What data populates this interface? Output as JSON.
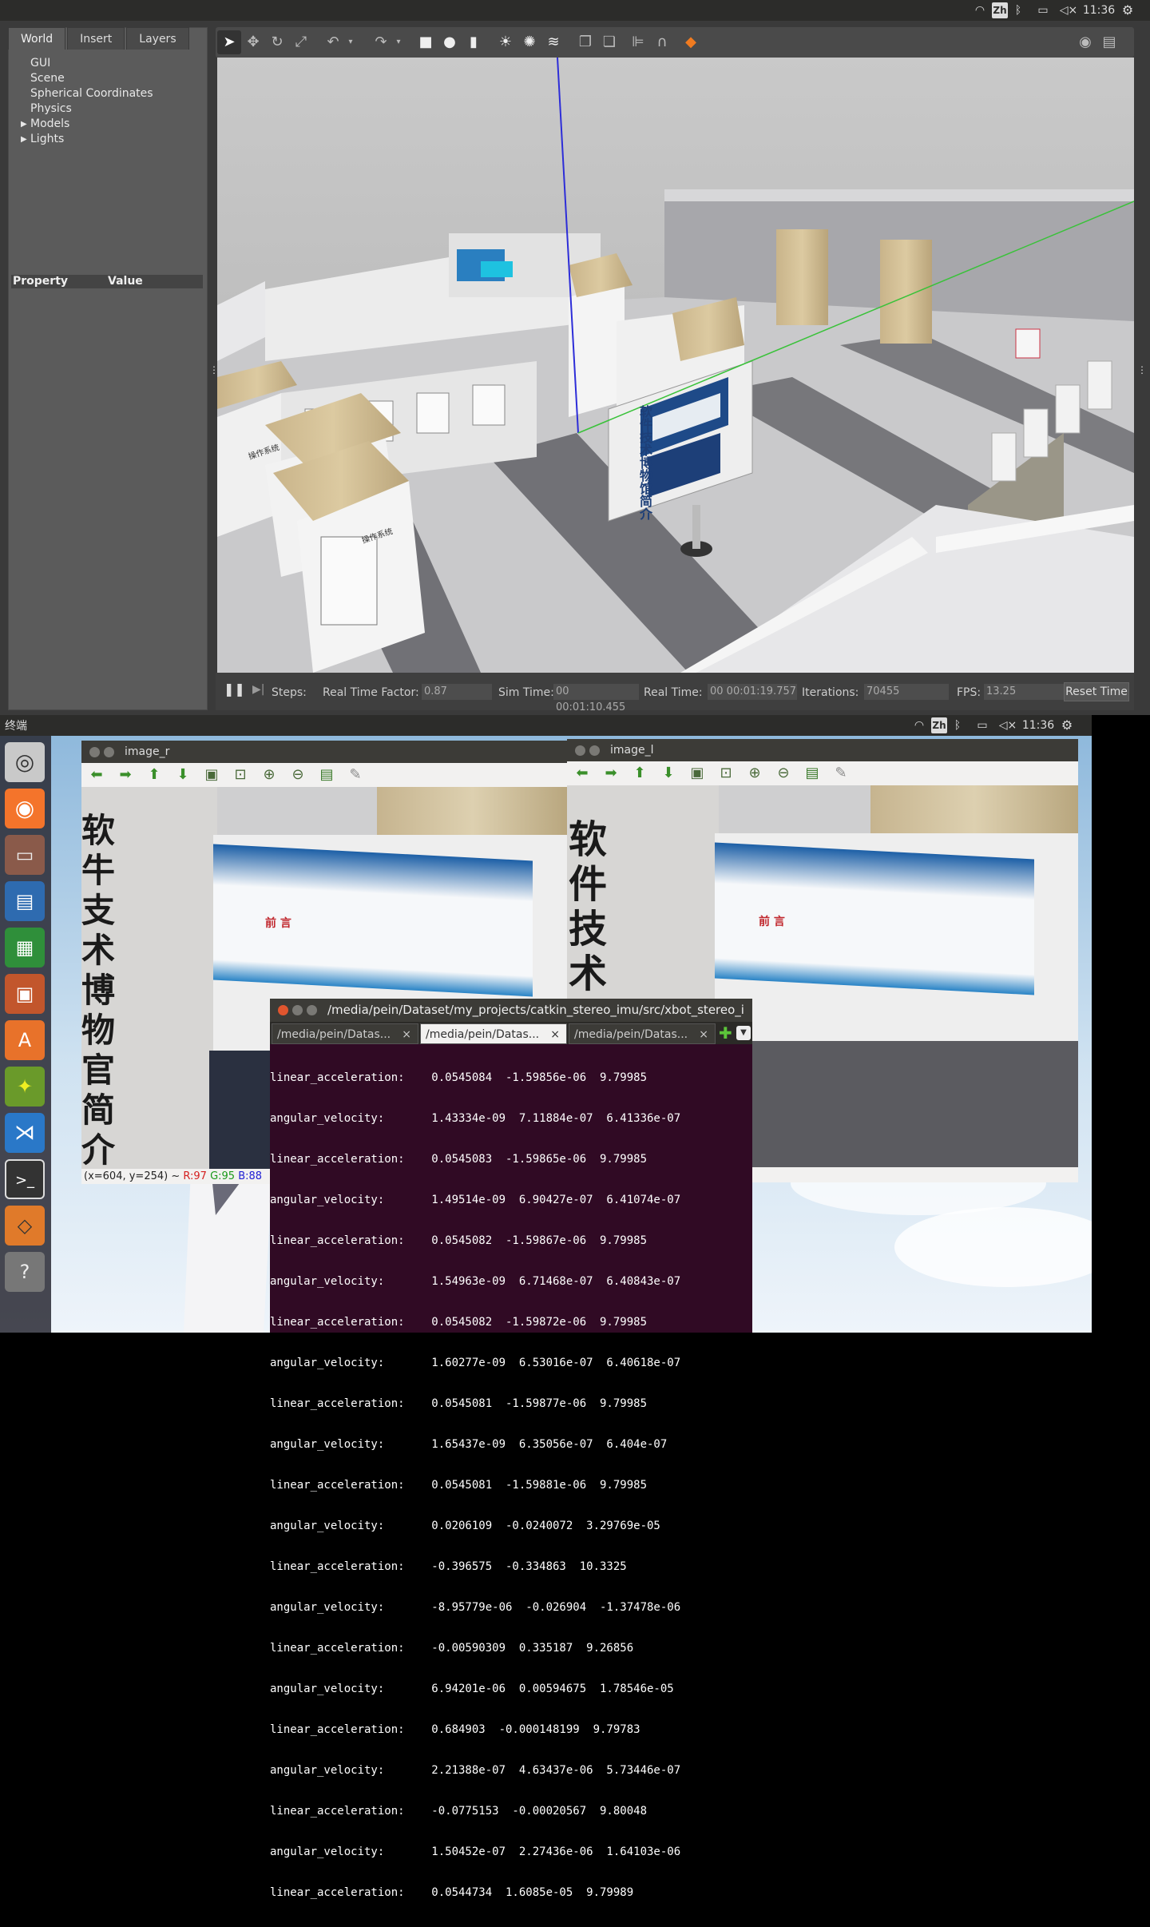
{
  "top_panel": {
    "ime": "Zh",
    "time": "11:36"
  },
  "gazebo": {
    "tabs": [
      "World",
      "Insert",
      "Layers"
    ],
    "tree": [
      "GUI",
      "Scene",
      "Spherical Coordinates",
      "Physics",
      "Models",
      "Lights"
    ],
    "property_header": "Property",
    "value_header": "Value",
    "status": {
      "steps_label": "Steps:",
      "rtf_label": "Real Time Factor:",
      "rtf_value": "0.87",
      "sim_time_label": "Sim Time:",
      "sim_time_value": "00 00:01:10.455",
      "real_time_label": "Real Time:",
      "real_time_value": "00 00:01:19.757",
      "iterations_label": "Iterations:",
      "iterations_value": "70455",
      "fps_label": "FPS:",
      "fps_value": "13.25",
      "reset_label": "Reset Time"
    },
    "scene_signs": {
      "board_text": "软件技术博物馆简介",
      "panel1": "操作系统",
      "panel2": "操作系统"
    }
  },
  "screen2": {
    "app_title": "终端",
    "ime": "Zh",
    "time": "11:36"
  },
  "image_r": {
    "title": "image_r",
    "pixel_prefix": "(x=604, y=254) ~",
    "r": "R:97",
    "g": "G:95",
    "b": "B:88",
    "big_text": "软牛支术博物官简介",
    "poster_title": "前 言"
  },
  "image_l": {
    "title": "image_l",
    "big_text": "软件技术",
    "poster_title": "前 言"
  },
  "terminal": {
    "title": "/media/pein/Dataset/my_projects/catkin_stereo_imu/src/xbot_stereo_i",
    "tabs": [
      "/media/pein/Datas...",
      "/media/pein/Datas...",
      "/media/pein/Datas..."
    ],
    "lines": [
      "linear_acceleration:    0.0545084  -1.59856e-06  9.79985",
      "angular_velocity:       1.43334e-09  7.11884e-07  6.41336e-07",
      "linear_acceleration:    0.0545083  -1.59865e-06  9.79985",
      "angular_velocity:       1.49514e-09  6.90427e-07  6.41074e-07",
      "linear_acceleration:    0.0545082  -1.59867e-06  9.79985",
      "angular_velocity:       1.54963e-09  6.71468e-07  6.40843e-07",
      "linear_acceleration:    0.0545082  -1.59872e-06  9.79985",
      "angular_velocity:       1.60277e-09  6.53016e-07  6.40618e-07",
      "linear_acceleration:    0.0545081  -1.59877e-06  9.79985",
      "angular_velocity:       1.65437e-09  6.35056e-07  6.404e-07",
      "linear_acceleration:    0.0545081  -1.59881e-06  9.79985",
      "angular_velocity:       0.0206109  -0.0240072  3.29769e-05",
      "linear_acceleration:    -0.396575  -0.334863  10.3325",
      "angular_velocity:       -8.95779e-06  -0.026904  -1.37478e-06",
      "linear_acceleration:    -0.00590309  0.335187  9.26856",
      "angular_velocity:       6.94201e-06  0.00594675  1.78546e-05",
      "linear_acceleration:    0.684903  -0.000148199  9.79783",
      "angular_velocity:       2.21388e-07  4.63437e-06  5.73446e-07",
      "linear_acceleration:    -0.0775153  -0.00020567  9.80048",
      "angular_velocity:       1.50452e-07  2.27436e-06  1.64103e-06",
      "linear_acceleration:    0.0544734  1.6085e-05  9.79989"
    ]
  }
}
